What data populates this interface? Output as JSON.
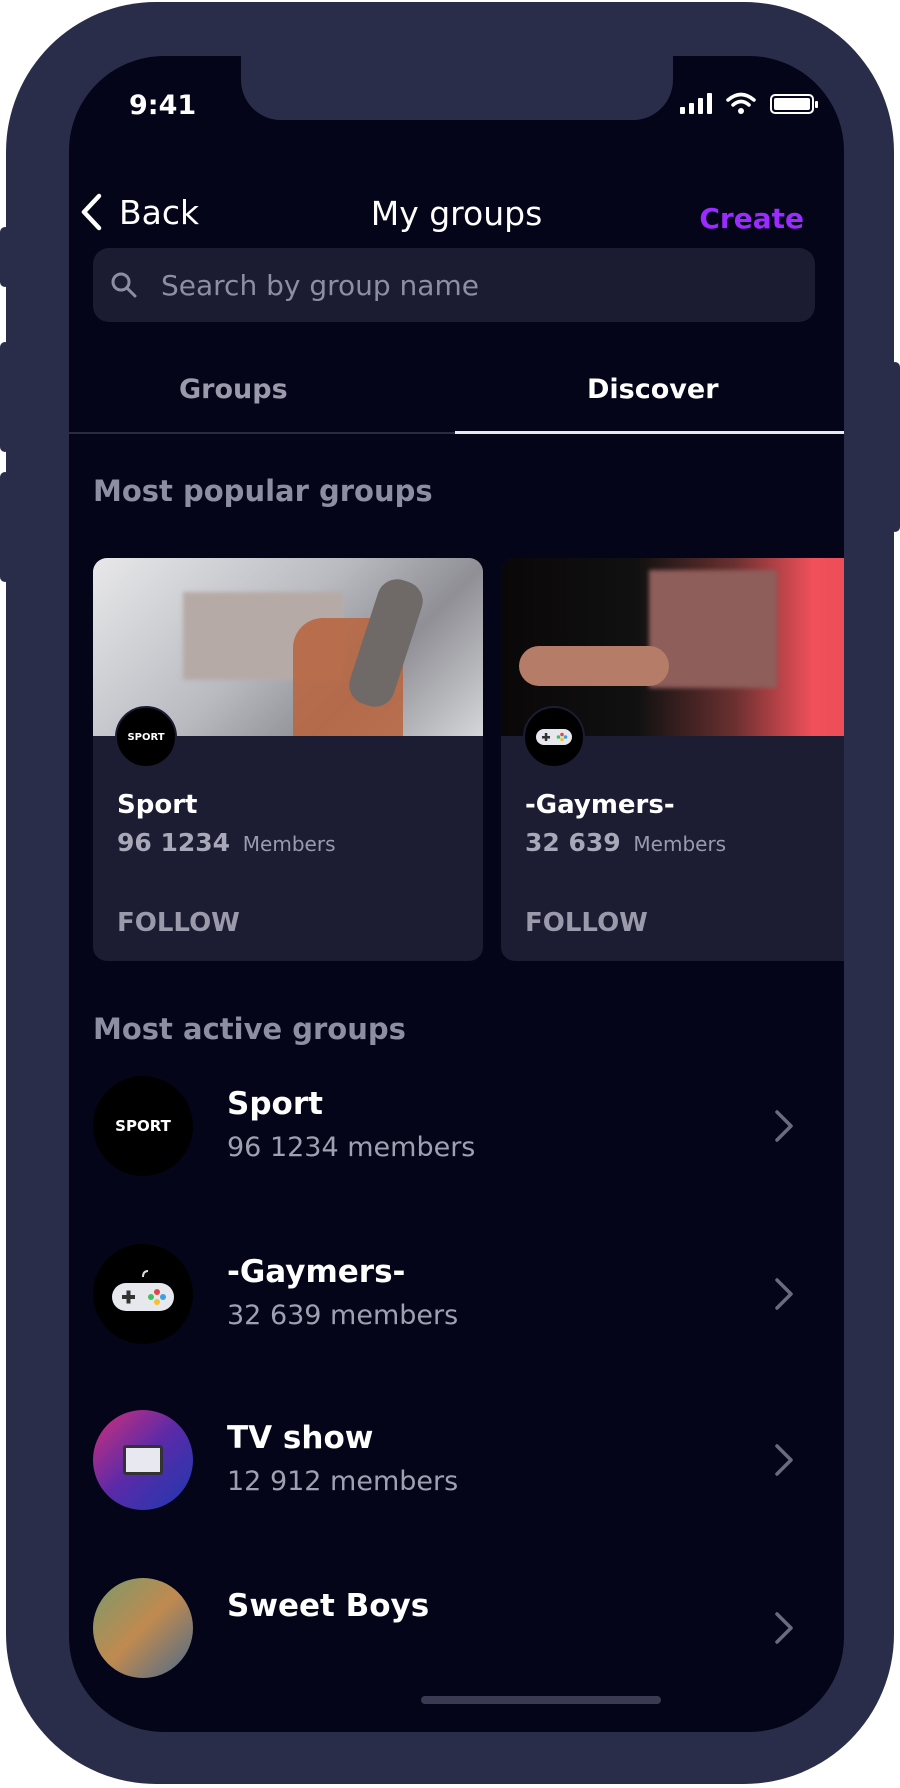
{
  "status": {
    "time": "9:41"
  },
  "nav": {
    "back_label": "Back",
    "title": "My groups",
    "create_label": "Create"
  },
  "search": {
    "placeholder": "Search by group name"
  },
  "tabs": [
    {
      "label": "Groups",
      "active": false
    },
    {
      "label": "Discover",
      "active": true
    }
  ],
  "popular": {
    "title": "Most popular groups",
    "cards": [
      {
        "name": "Sport",
        "count": "96 1234",
        "members_label": "Members",
        "follow_label": "FOLLOW",
        "badge": "SPORT"
      },
      {
        "name": "-Gaymers-",
        "count": "32 639",
        "members_label": "Members",
        "follow_label": "FOLLOW",
        "icon": "gamepad-icon"
      }
    ]
  },
  "active": {
    "title": "Most active groups",
    "rows": [
      {
        "name": "Sport",
        "count": "96 1234 members",
        "badge": "SPORT"
      },
      {
        "name": "-Gaymers-",
        "count": "32 639 members",
        "icon": "gamepad-icon"
      },
      {
        "name": "TV show",
        "count": "12 912 members",
        "icon": "tv-icon"
      },
      {
        "name": "Sweet Boys",
        "count": ""
      }
    ]
  },
  "colors": {
    "accent": "#9b2cff",
    "background": "#050519",
    "card": "#1c1c33",
    "frame": "#2a2d49"
  }
}
